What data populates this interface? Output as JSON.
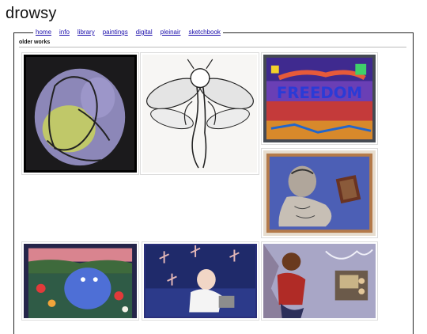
{
  "site": {
    "title": "drowsy"
  },
  "nav": {
    "items": [
      {
        "label": "home"
      },
      {
        "label": "info"
      },
      {
        "label": "library"
      },
      {
        "label": "paintings"
      },
      {
        "label": "digital"
      },
      {
        "label": "pleinair"
      },
      {
        "label": "sketchbook"
      }
    ]
  },
  "gallery": {
    "section_title": "older works",
    "images": [
      {
        "subject": "embracing-figures-painting"
      },
      {
        "subject": "bee-woman-ink-drawing"
      },
      {
        "subject": "freedom-graffiti-painting",
        "painted_text": "FREEDOM"
      },
      {
        "subject": "tattooed-man-portrait-painting"
      },
      {
        "subject": "blue-creature-flowers-painting"
      },
      {
        "subject": "dragonflies-girl-painting"
      },
      {
        "subject": "figure-and-radio-painting"
      }
    ]
  }
}
